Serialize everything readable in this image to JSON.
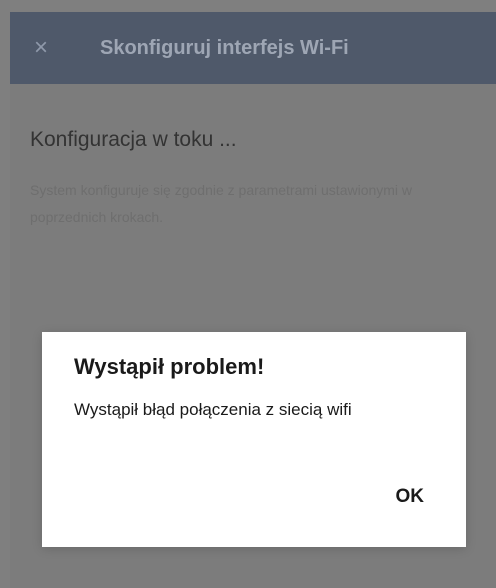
{
  "header": {
    "close_icon": "×",
    "title": "Skonfiguruj interfejs Wi-Fi"
  },
  "main": {
    "heading": "Konfiguracja w toku ...",
    "description": "System konfiguruje się zgodnie z parametrami ustawionymi w poprzednich krokach."
  },
  "dialog": {
    "title": "Wystąpił problem!",
    "message": "Wystąpił błąd połączenia z siecią wifi",
    "ok_label": "OK"
  },
  "colors": {
    "header_bg": "#4f596a",
    "overlay_bg": "#7f7f7f",
    "dialog_bg": "#ffffff"
  }
}
